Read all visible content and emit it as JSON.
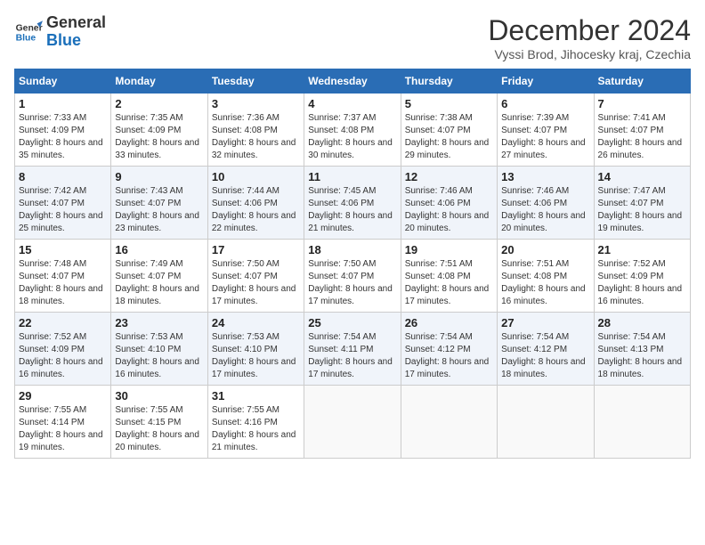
{
  "header": {
    "logo_line1": "General",
    "logo_line2": "Blue",
    "month_title": "December 2024",
    "location": "Vyssi Brod, Jihocesky kraj, Czechia"
  },
  "weekdays": [
    "Sunday",
    "Monday",
    "Tuesday",
    "Wednesday",
    "Thursday",
    "Friday",
    "Saturday"
  ],
  "weeks": [
    [
      {
        "day": "1",
        "sunrise": "7:33 AM",
        "sunset": "4:09 PM",
        "daylight": "8 hours and 35 minutes."
      },
      {
        "day": "2",
        "sunrise": "7:35 AM",
        "sunset": "4:09 PM",
        "daylight": "8 hours and 33 minutes."
      },
      {
        "day": "3",
        "sunrise": "7:36 AM",
        "sunset": "4:08 PM",
        "daylight": "8 hours and 32 minutes."
      },
      {
        "day": "4",
        "sunrise": "7:37 AM",
        "sunset": "4:08 PM",
        "daylight": "8 hours and 30 minutes."
      },
      {
        "day": "5",
        "sunrise": "7:38 AM",
        "sunset": "4:07 PM",
        "daylight": "8 hours and 29 minutes."
      },
      {
        "day": "6",
        "sunrise": "7:39 AM",
        "sunset": "4:07 PM",
        "daylight": "8 hours and 27 minutes."
      },
      {
        "day": "7",
        "sunrise": "7:41 AM",
        "sunset": "4:07 PM",
        "daylight": "8 hours and 26 minutes."
      }
    ],
    [
      {
        "day": "8",
        "sunrise": "7:42 AM",
        "sunset": "4:07 PM",
        "daylight": "8 hours and 25 minutes."
      },
      {
        "day": "9",
        "sunrise": "7:43 AM",
        "sunset": "4:07 PM",
        "daylight": "8 hours and 23 minutes."
      },
      {
        "day": "10",
        "sunrise": "7:44 AM",
        "sunset": "4:06 PM",
        "daylight": "8 hours and 22 minutes."
      },
      {
        "day": "11",
        "sunrise": "7:45 AM",
        "sunset": "4:06 PM",
        "daylight": "8 hours and 21 minutes."
      },
      {
        "day": "12",
        "sunrise": "7:46 AM",
        "sunset": "4:06 PM",
        "daylight": "8 hours and 20 minutes."
      },
      {
        "day": "13",
        "sunrise": "7:46 AM",
        "sunset": "4:06 PM",
        "daylight": "8 hours and 20 minutes."
      },
      {
        "day": "14",
        "sunrise": "7:47 AM",
        "sunset": "4:07 PM",
        "daylight": "8 hours and 19 minutes."
      }
    ],
    [
      {
        "day": "15",
        "sunrise": "7:48 AM",
        "sunset": "4:07 PM",
        "daylight": "8 hours and 18 minutes."
      },
      {
        "day": "16",
        "sunrise": "7:49 AM",
        "sunset": "4:07 PM",
        "daylight": "8 hours and 18 minutes."
      },
      {
        "day": "17",
        "sunrise": "7:50 AM",
        "sunset": "4:07 PM",
        "daylight": "8 hours and 17 minutes."
      },
      {
        "day": "18",
        "sunrise": "7:50 AM",
        "sunset": "4:07 PM",
        "daylight": "8 hours and 17 minutes."
      },
      {
        "day": "19",
        "sunrise": "7:51 AM",
        "sunset": "4:08 PM",
        "daylight": "8 hours and 17 minutes."
      },
      {
        "day": "20",
        "sunrise": "7:51 AM",
        "sunset": "4:08 PM",
        "daylight": "8 hours and 16 minutes."
      },
      {
        "day": "21",
        "sunrise": "7:52 AM",
        "sunset": "4:09 PM",
        "daylight": "8 hours and 16 minutes."
      }
    ],
    [
      {
        "day": "22",
        "sunrise": "7:52 AM",
        "sunset": "4:09 PM",
        "daylight": "8 hours and 16 minutes."
      },
      {
        "day": "23",
        "sunrise": "7:53 AM",
        "sunset": "4:10 PM",
        "daylight": "8 hours and 16 minutes."
      },
      {
        "day": "24",
        "sunrise": "7:53 AM",
        "sunset": "4:10 PM",
        "daylight": "8 hours and 17 minutes."
      },
      {
        "day": "25",
        "sunrise": "7:54 AM",
        "sunset": "4:11 PM",
        "daylight": "8 hours and 17 minutes."
      },
      {
        "day": "26",
        "sunrise": "7:54 AM",
        "sunset": "4:12 PM",
        "daylight": "8 hours and 17 minutes."
      },
      {
        "day": "27",
        "sunrise": "7:54 AM",
        "sunset": "4:12 PM",
        "daylight": "8 hours and 18 minutes."
      },
      {
        "day": "28",
        "sunrise": "7:54 AM",
        "sunset": "4:13 PM",
        "daylight": "8 hours and 18 minutes."
      }
    ],
    [
      {
        "day": "29",
        "sunrise": "7:55 AM",
        "sunset": "4:14 PM",
        "daylight": "8 hours and 19 minutes."
      },
      {
        "day": "30",
        "sunrise": "7:55 AM",
        "sunset": "4:15 PM",
        "daylight": "8 hours and 20 minutes."
      },
      {
        "day": "31",
        "sunrise": "7:55 AM",
        "sunset": "4:16 PM",
        "daylight": "8 hours and 21 minutes."
      },
      null,
      null,
      null,
      null
    ]
  ]
}
